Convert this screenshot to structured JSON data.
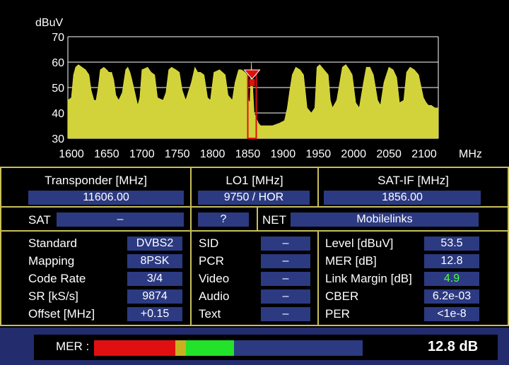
{
  "chart_data": {
    "type": "area",
    "ylabel": "dBuV",
    "xlabel": "MHz",
    "xlim": [
      1595,
      2120
    ],
    "ylim": [
      30,
      70
    ],
    "xticks": [
      "1600",
      "1650",
      "1700",
      "1750",
      "1800",
      "1850",
      "1900",
      "1950",
      "2000",
      "2050",
      "2100"
    ],
    "yticks": [
      "30",
      "40",
      "50",
      "60",
      "70"
    ],
    "marker_freq": 1856,
    "grid": true,
    "series": [
      {
        "x": [
          1595,
          1600,
          1603,
          1606,
          1610,
          1620,
          1625,
          1628,
          1632,
          1635,
          1638,
          1641,
          1646,
          1650,
          1653,
          1657,
          1660,
          1663,
          1667,
          1672,
          1677,
          1680,
          1683,
          1685,
          1690,
          1694,
          1697,
          1700,
          1708,
          1713,
          1718,
          1722,
          1730,
          1734,
          1738,
          1742,
          1748,
          1753,
          1757,
          1762,
          1770,
          1775,
          1779,
          1783,
          1788,
          1793,
          1797,
          1802,
          1810,
          1814,
          1818,
          1822,
          1828,
          1832,
          1837,
          1841,
          1846,
          1849,
          1851,
          1853,
          1855,
          1859,
          1862,
          1865,
          1868,
          1875,
          1885,
          1895,
          1902,
          1906,
          1909,
          1913,
          1918,
          1924,
          1929,
          1934,
          1940,
          1945,
          1948,
          1952,
          1958,
          1964,
          1967,
          1970,
          1976,
          1984,
          1989,
          1994,
          1998,
          2003,
          2008,
          2014,
          2018,
          2023,
          2028,
          2034,
          2038,
          2043,
          2050,
          2056,
          2061,
          2065,
          2071,
          2075,
          2080,
          2086,
          2092,
          2099,
          2103,
          2106,
          2110,
          2115,
          2120
        ],
        "y": [
          45,
          46,
          55,
          58,
          59,
          57,
          55,
          49,
          45,
          45,
          50,
          57,
          58,
          57,
          56,
          56,
          53,
          47,
          45,
          48,
          57,
          58,
          56,
          54,
          48,
          43,
          46,
          57,
          58,
          56,
          55,
          46,
          45,
          48,
          57,
          58,
          57,
          56,
          49,
          45,
          52,
          58,
          56,
          56,
          55,
          46,
          45,
          56,
          57,
          56,
          55,
          47,
          45,
          52,
          57,
          57,
          56,
          55,
          45,
          44,
          60,
          40,
          38,
          36,
          35,
          35,
          35,
          36,
          37,
          42,
          48,
          55,
          58,
          57,
          55,
          42,
          40,
          42,
          58,
          59,
          57,
          55,
          45,
          42,
          45,
          58,
          59,
          57,
          55,
          44,
          42,
          52,
          58,
          58,
          55,
          45,
          43,
          52,
          58,
          57,
          54,
          44,
          45,
          56,
          58,
          57,
          55,
          46,
          44,
          43,
          43,
          42,
          42
        ]
      }
    ]
  },
  "table": {
    "transponder_label": "Transponder [MHz]",
    "transponder_value": "11606.00",
    "lo1_label": "LO1 [MHz]",
    "lo1_value": "9750 / HOR",
    "satif_label": "SAT-IF [MHz]",
    "satif_value": "1856.00",
    "sat_label": "SAT",
    "sat_value": "–",
    "unknown_value": "?",
    "net_label": "NET",
    "net_value": "Mobilelinks"
  },
  "params_left": [
    {
      "label": "Standard",
      "value": "DVBS2"
    },
    {
      "label": "Mapping",
      "value": "8PSK"
    },
    {
      "label": "Code Rate",
      "value": "3/4"
    },
    {
      "label": "SR [kS/s]",
      "value": "9874"
    },
    {
      "label": "Offset [MHz]",
      "value": "+0.15"
    }
  ],
  "params_mid": [
    {
      "label": "SID",
      "value": "–"
    },
    {
      "label": "PCR",
      "value": "–"
    },
    {
      "label": "Video",
      "value": "–"
    },
    {
      "label": "Audio",
      "value": "–"
    },
    {
      "label": "Text",
      "value": "–"
    }
  ],
  "params_right": [
    {
      "label": "Level [dBuV]",
      "value": "53.5"
    },
    {
      "label": "MER [dB]",
      "value": "12.8"
    },
    {
      "label": "Link Margin [dB]",
      "value": "4.9"
    },
    {
      "label": "CBER",
      "value": "6.2e-03"
    },
    {
      "label": "PER",
      "value": "<1e-8"
    }
  ],
  "mer_bar": {
    "label": "MER :",
    "value_text": "12.8 dB",
    "fill_fraction": 0.52,
    "colors": {
      "red": "#e01010",
      "yellow": "#c8b020",
      "green": "#22e22a",
      "track": "#2c3a82"
    }
  },
  "colors": {
    "trace": "#d2d23a",
    "marker": "#e01010",
    "border": "#c8bf5a",
    "value_bg": "#2c3a82",
    "margin_ok": "#4cff3c"
  }
}
